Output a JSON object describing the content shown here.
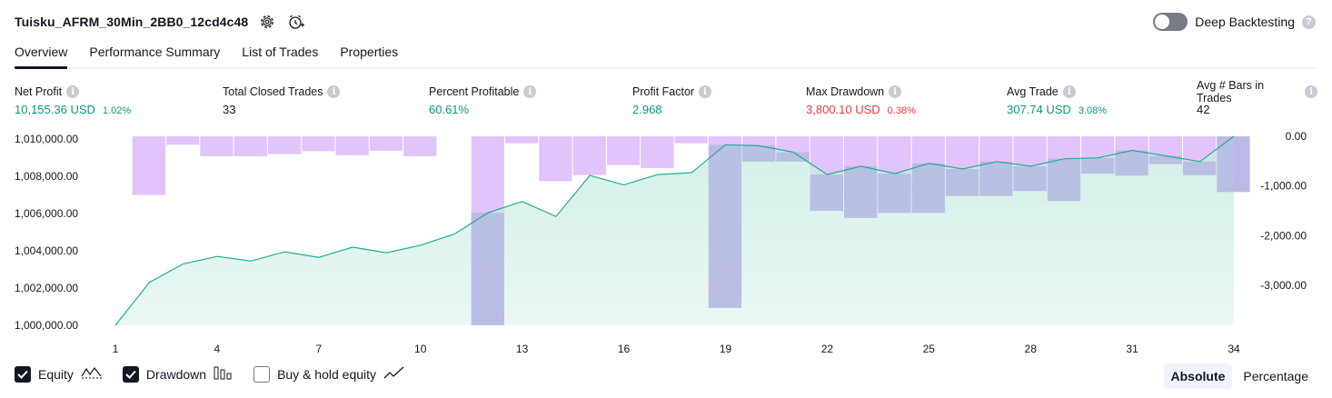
{
  "header": {
    "strategy_name": "Tuisku_AFRM_30Min_2BB0_12cd4c48"
  },
  "deep_backtesting": {
    "label": "Deep Backtesting",
    "enabled": false,
    "help": "?"
  },
  "tabs": [
    {
      "label": "Overview",
      "active": true
    },
    {
      "label": "Performance Summary",
      "active": false
    },
    {
      "label": "List of Trades",
      "active": false
    },
    {
      "label": "Properties",
      "active": false
    }
  ],
  "metrics": {
    "info_glyph": "i",
    "net_profit": {
      "label": "Net Profit",
      "value": "10,155.36 USD",
      "pct": "1.02%"
    },
    "total_closed_trades": {
      "label": "Total Closed Trades",
      "value": "33"
    },
    "percent_profitable": {
      "label": "Percent Profitable",
      "value": "60.61%"
    },
    "profit_factor": {
      "label": "Profit Factor",
      "value": "2.968"
    },
    "max_drawdown": {
      "label": "Max Drawdown",
      "value": "3,800.10 USD",
      "pct": "0.38%"
    },
    "avg_trade": {
      "label": "Avg Trade",
      "value": "307.74 USD",
      "pct": "3.08%"
    },
    "avg_bars": {
      "label": "Avg # Bars in Trades",
      "value": "42"
    }
  },
  "colors": {
    "positive": "#089981",
    "negative": "#f23645",
    "equity_line": "#22ab94",
    "equity_fill": "#c9ece3",
    "drawdown_bar": "#e1c4fb",
    "overlap_bar": "#b0b6e0"
  },
  "chart_data": {
    "type": "area",
    "x_ticks": [
      1,
      4,
      7,
      10,
      13,
      16,
      19,
      22,
      25,
      28,
      31,
      34
    ],
    "left_axis": {
      "ticks": [
        "1,010,000.00",
        "1,008,000.00",
        "1,006,000.00",
        "1,004,000.00",
        "1,002,000.00",
        "1,000,000.00"
      ],
      "ylim": [
        1000000,
        1010155.36
      ]
    },
    "right_axis": {
      "ticks": [
        "0.00",
        "-1,000.00",
        "-2,000.00",
        "-3,000.00"
      ],
      "ylim": [
        -3800.1,
        0
      ]
    },
    "series": [
      {
        "name": "Equity",
        "x": [
          1,
          2,
          3,
          4,
          5,
          6,
          7,
          8,
          9,
          10,
          11,
          12,
          13,
          14,
          15,
          16,
          17,
          18,
          19,
          20,
          21,
          22,
          23,
          24,
          25,
          26,
          27,
          28,
          29,
          30,
          31,
          32,
          33,
          34
        ],
        "values": [
          1000000,
          1002300,
          1003300,
          1003700,
          1003450,
          1003950,
          1003650,
          1004200,
          1003900,
          1004300,
          1004900,
          1006050,
          1006650,
          1005850,
          1008050,
          1007550,
          1008100,
          1008200,
          1009700,
          1009650,
          1009300,
          1008100,
          1008550,
          1008150,
          1008700,
          1008400,
          1008800,
          1008550,
          1008950,
          1009000,
          1009400,
          1009100,
          1008800,
          1010155.36
        ]
      },
      {
        "name": "Drawdown",
        "x": [
          2,
          3,
          4,
          5,
          6,
          7,
          8,
          9,
          10,
          12,
          13,
          14,
          15,
          16,
          17,
          18,
          19,
          20,
          21,
          22,
          23,
          24,
          25,
          26,
          27,
          28,
          29,
          30,
          31,
          32,
          33,
          34
        ],
        "values": [
          -1180,
          -170,
          -400,
          -400,
          -360,
          -300,
          -380,
          -290,
          -400,
          -3800,
          -140,
          -900,
          -780,
          -580,
          -640,
          -140,
          -3450,
          -510,
          -510,
          -1500,
          -1640,
          -1540,
          -1540,
          -1200,
          -1200,
          -1100,
          -1300,
          -750,
          -790,
          -560,
          -780,
          -1120
        ]
      }
    ]
  },
  "legend": [
    {
      "label": "Equity",
      "checked": true
    },
    {
      "label": "Drawdown",
      "checked": true
    },
    {
      "label": "Buy & hold equity",
      "checked": false
    }
  ],
  "display_mode": {
    "absolute": "Absolute",
    "percentage": "Percentage",
    "selected": "Absolute"
  }
}
